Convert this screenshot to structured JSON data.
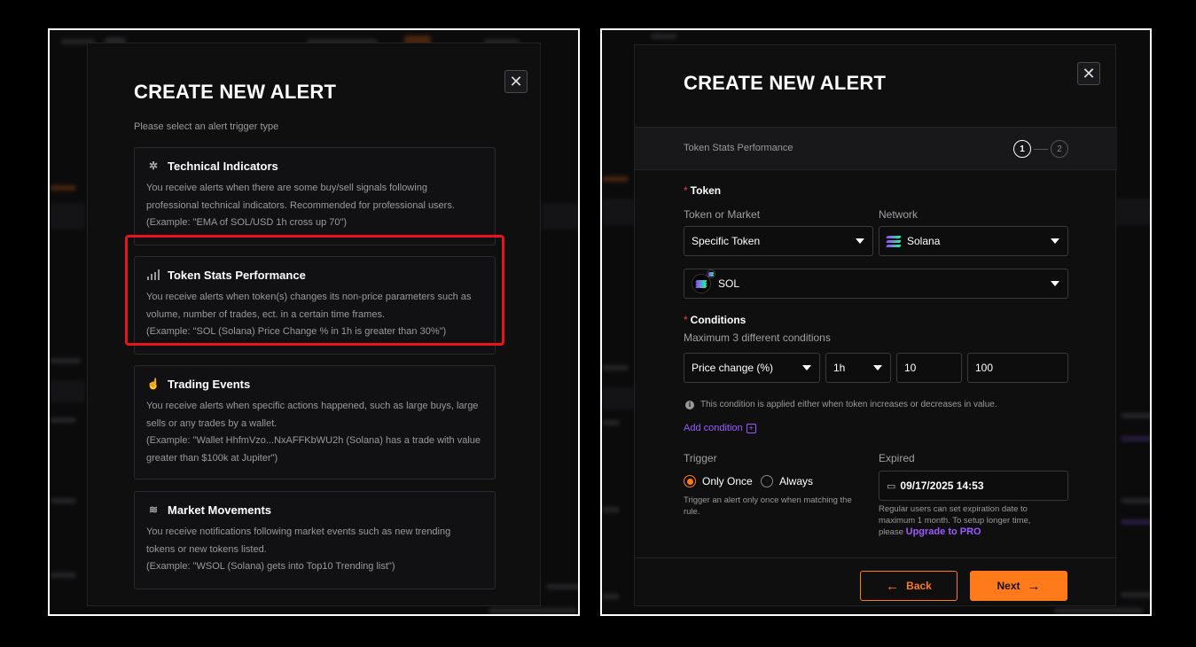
{
  "left_modal": {
    "title": "CREATE NEW ALERT",
    "subtitle": "Please select an alert trigger type",
    "cards": [
      {
        "icon": "gear-cog-icon",
        "title": "Technical Indicators",
        "desc": [
          "You receive alerts when there are some buy/sell signals following",
          "professional technical indicators. Recommended for professional users.",
          "(Example: \"EMA of SOL/USD 1h cross up 70\")"
        ]
      },
      {
        "icon": "bar-chart-icon",
        "title": "Token Stats Performance",
        "desc": [
          "You receive alerts when token(s) changes its non-price parameters such as",
          "volume, number of trades, ect. in a certain time frames.",
          "(Example: \"SOL (Solana) Price Change % in 1h is greater than 30%\")"
        ]
      },
      {
        "icon": "hand-pointer-icon",
        "title": "Trading Events",
        "desc": [
          "You receive alerts when specific actions happened, such as large buys, large",
          "sells or any trades by a wallet.",
          "(Example: \"Wallet HhfmVzo...NxAFFKbWU2h (Solana) has a trade with value",
          "greater than $100k at Jupiter\")"
        ]
      },
      {
        "icon": "wind-lines-icon",
        "title": "Market Movements",
        "desc": [
          "You receive notifications following market events such as new trending",
          "tokens or new tokens listed.",
          "(Example: \"WSOL (Solana) gets into Top10 Trending list\")"
        ]
      }
    ],
    "close_glyph": "✕"
  },
  "right_modal": {
    "title": "CREATE NEW ALERT",
    "close_glyph": "✕",
    "step_label": "Token Stats Performance",
    "step1": "1",
    "step2": "2",
    "token_section": "Token",
    "token_or_market_label": "Token or Market",
    "token_or_market_value": "Specific Token",
    "network_label": "Network",
    "network_value": "Solana",
    "token_value": "SOL",
    "conditions_section": "Conditions",
    "conditions_hint": "Maximum 3 different conditions",
    "condition_metric": "Price change (%)",
    "condition_timeframe": "1h",
    "condition_min": "10",
    "condition_max": "100",
    "condition_note": "This condition is applied either when token increases or decreases in value.",
    "add_condition": "Add condition",
    "trigger_label": "Trigger",
    "trigger_once": "Only Once",
    "trigger_always": "Always",
    "trigger_help": [
      "Trigger an alert only once when matching the",
      "rule."
    ],
    "expired_label": "Expired",
    "expired_value": "09/17/2025 14:53",
    "expired_help": [
      "Regular users can set expiration date to",
      "maximum 1 month. To setup longer time,",
      "please "
    ],
    "upgrade_link": "Upgrade to PRO",
    "back_button": "Back",
    "next_button": "Next",
    "required_mark": "*"
  },
  "colors": {
    "accent": "#ff7a1a",
    "link": "#9b5cff",
    "highlight": "#e8141b"
  }
}
